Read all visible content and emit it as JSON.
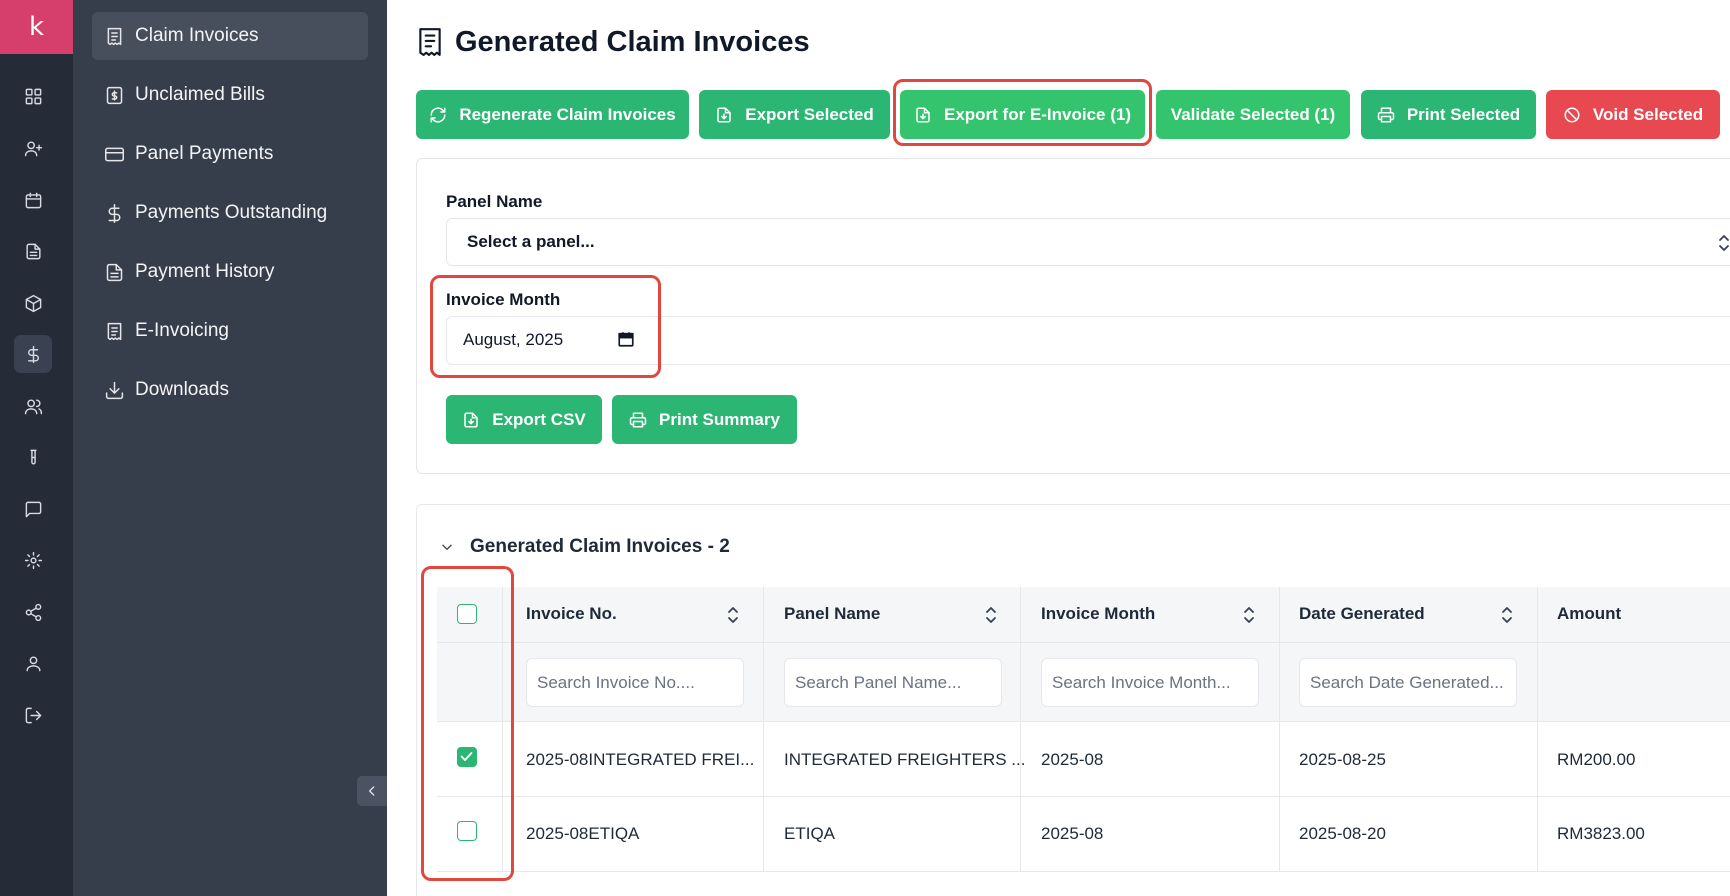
{
  "brand": {
    "logo_letter": "k",
    "color": "#d63f6b"
  },
  "rail": {
    "icons": [
      "dashboard-icon",
      "user-plus-icon",
      "calendar-icon",
      "document-icon",
      "box-icon",
      "dollar-icon",
      "users-icon",
      "test-tube-icon",
      "message-icon",
      "gear-icon",
      "share-icon",
      "user-icon",
      "logout-icon"
    ],
    "active": "dollar-icon"
  },
  "menu": {
    "items": [
      {
        "label": "Claim Invoices",
        "icon": "receipt-icon",
        "active": true
      },
      {
        "label": "Unclaimed Bills",
        "icon": "bill-icon",
        "active": false
      },
      {
        "label": "Panel Payments",
        "icon": "card-icon",
        "active": false
      },
      {
        "label": "Payments Outstanding",
        "icon": "dollar-icon",
        "active": false
      },
      {
        "label": "Payment History",
        "icon": "file-text-icon",
        "active": false
      },
      {
        "label": "E-Invoicing",
        "icon": "receipt-icon",
        "active": false
      },
      {
        "label": "Downloads",
        "icon": "download-icon",
        "active": false
      }
    ]
  },
  "page": {
    "title": "Generated Claim Invoices"
  },
  "toolbar": {
    "regenerate": "Regenerate Claim Invoices",
    "export_selected": "Export Selected",
    "export_einvoice": "Export for E-Invoice (1)",
    "validate_selected": "Validate Selected (1)",
    "print_selected": "Print Selected",
    "void_selected": "Void Selected"
  },
  "filters": {
    "panel_label": "Panel Name",
    "panel_value": "Select a panel...",
    "month_label": "Invoice Month",
    "month_value": "August, 2025",
    "export_csv": "Export CSV",
    "print_summary": "Print Summary"
  },
  "table": {
    "title": "Generated Claim Invoices - 2",
    "columns": [
      "Invoice No.",
      "Panel Name",
      "Invoice Month",
      "Date Generated",
      "Amount"
    ],
    "search_placeholders": [
      "Search Invoice No....",
      "Search Panel Name...",
      "Search Invoice Month...",
      "Search Date Generated..."
    ],
    "rows": [
      {
        "checked": true,
        "invoice_no": "2025-08INTEGRATED FREI...",
        "panel": "INTEGRATED FREIGHTERS ...",
        "month": "2025-08",
        "date": "2025-08-25",
        "amount": "RM200.00"
      },
      {
        "checked": false,
        "invoice_no": "2025-08ETIQA",
        "panel": "ETIQA",
        "month": "2025-08",
        "date": "2025-08-20",
        "amount": "RM3823.00"
      }
    ]
  },
  "colors": {
    "primary_green": "#2bb673",
    "bright_green": "#33c46d",
    "danger": "#e8484f",
    "highlight": "#e0483f"
  }
}
